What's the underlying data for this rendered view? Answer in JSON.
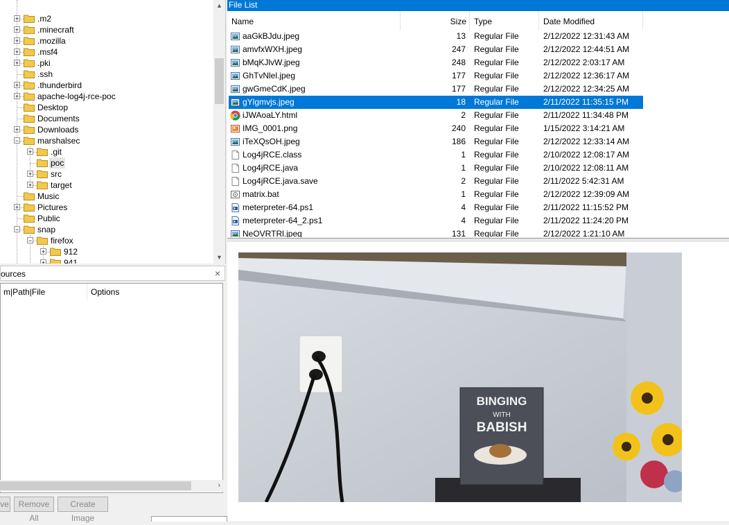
{
  "tree": {
    "items": [
      {
        "label": ".m2",
        "expander": "+"
      },
      {
        "label": ".minecraft",
        "expander": "+"
      },
      {
        "label": ".mozilla",
        "expander": "+"
      },
      {
        "label": ".msf4",
        "expander": "+"
      },
      {
        "label": ".pki",
        "expander": "+"
      },
      {
        "label": ".ssh",
        "expander": ""
      },
      {
        "label": ".thunderbird",
        "expander": "+"
      },
      {
        "label": "apache-log4j-rce-poc",
        "expander": "+"
      },
      {
        "label": "Desktop",
        "expander": ""
      },
      {
        "label": "Documents",
        "expander": ""
      },
      {
        "label": "Downloads",
        "expander": "+"
      },
      {
        "label": "marshalsec",
        "expander": "−"
      },
      {
        "label": ".git",
        "expander": "+"
      },
      {
        "label": "poc",
        "expander": ""
      },
      {
        "label": "src",
        "expander": "+"
      },
      {
        "label": "target",
        "expander": "+"
      },
      {
        "label": "Music",
        "expander": ""
      },
      {
        "label": "Pictures",
        "expander": "+"
      },
      {
        "label": "Public",
        "expander": ""
      },
      {
        "label": "snap",
        "expander": "−"
      },
      {
        "label": "firefox",
        "expander": "−"
      },
      {
        "label": "912",
        "expander": "+"
      },
      {
        "label": "941",
        "expander": "+"
      }
    ]
  },
  "sources": {
    "title": "ources",
    "close": "×",
    "col1": "m|Path|File",
    "col2": "Options",
    "scroll_right": "›"
  },
  "buttons": {
    "remove": "ve",
    "remove_all": "Remove All",
    "create_image": "Create Image"
  },
  "file_list": {
    "title": "File List",
    "headers": {
      "name": "Name",
      "size": "Size",
      "type": "Type",
      "date": "Date Modified"
    },
    "rows": [
      {
        "name": "aaGkBJdu.jpeg",
        "size": "13",
        "type": "Regular File",
        "date": "2/12/2022 12:31:43 AM",
        "icon": "image-file-icon"
      },
      {
        "name": "amvfxWXH.jpeg",
        "size": "247",
        "type": "Regular File",
        "date": "2/12/2022 12:44:51 AM",
        "icon": "image-file-icon"
      },
      {
        "name": "bMqKJlvW.jpeg",
        "size": "248",
        "type": "Regular File",
        "date": "2/12/2022 2:03:17 AM",
        "icon": "image-file-icon"
      },
      {
        "name": "GhTvNlel.jpeg",
        "size": "177",
        "type": "Regular File",
        "date": "2/12/2022 12:36:17 AM",
        "icon": "image-file-icon"
      },
      {
        "name": "gwGmeCdK.jpeg",
        "size": "177",
        "type": "Regular File",
        "date": "2/12/2022 12:34:25 AM",
        "icon": "image-file-icon"
      },
      {
        "name": "gYlgmvjs.jpeg",
        "size": "18",
        "type": "Regular File",
        "date": "2/11/2022 11:35:15 PM",
        "icon": "image-file-icon"
      },
      {
        "name": "iJWAoaLY.html",
        "size": "2",
        "type": "Regular File",
        "date": "2/11/2022 11:34:48 PM",
        "icon": "chrome-icon"
      },
      {
        "name": "IMG_0001.png",
        "size": "240",
        "type": "Regular File",
        "date": "1/15/2022 3:14:21 AM",
        "icon": "png-file-icon"
      },
      {
        "name": "iTeXQsOH.jpeg",
        "size": "186",
        "type": "Regular File",
        "date": "2/12/2022 12:33:14 AM",
        "icon": "image-file-icon"
      },
      {
        "name": "Log4jRCE.class",
        "size": "1",
        "type": "Regular File",
        "date": "2/10/2022 12:08:17 AM",
        "icon": "document-icon"
      },
      {
        "name": "Log4jRCE.java",
        "size": "1",
        "type": "Regular File",
        "date": "2/10/2022 12:08:11 AM",
        "icon": "document-icon"
      },
      {
        "name": "Log4jRCE.java.save",
        "size": "2",
        "type": "Regular File",
        "date": "2/11/2022 5:42:31 AM",
        "icon": "document-icon"
      },
      {
        "name": "matrix.bat",
        "size": "1",
        "type": "Regular File",
        "date": "2/12/2022 12:39:09 AM",
        "icon": "batch-file-icon"
      },
      {
        "name": "meterpreter-64.ps1",
        "size": "4",
        "type": "Regular File",
        "date": "2/11/2022 11:15:52 PM",
        "icon": "powershell-file-icon"
      },
      {
        "name": "meterpreter-64_2.ps1",
        "size": "4",
        "type": "Regular File",
        "date": "2/11/2022 11:24:20 PM",
        "icon": "powershell-file-icon"
      },
      {
        "name": "NeOVRTRl.jpeg",
        "size": "131",
        "type": "Regular File",
        "date": "2/12/2022 1:21:10 AM",
        "icon": "image-file-icon"
      }
    ],
    "selected_index": 5
  },
  "preview": {
    "photo_text": {
      "line1": "BINGING",
      "line2": "WITH",
      "line3": "BABISH"
    }
  },
  "colors": {
    "accent": "#0078d7",
    "folder": "#f2c94c"
  }
}
